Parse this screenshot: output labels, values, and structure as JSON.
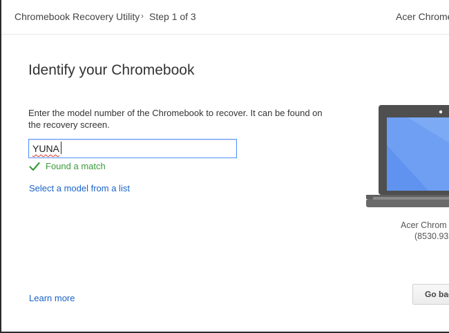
{
  "header": {
    "app_title": "Chromebook Recovery Utility",
    "separator": "›",
    "step": "Step 1 of 3",
    "device_name": "Acer Chrome"
  },
  "main": {
    "title": "Identify your Chromebook",
    "instructions": "Enter the model number of the Chromebook to recover. It can be found on the recovery screen.",
    "model_input": {
      "value": "YUNA",
      "placeholder": ""
    },
    "match_status": "Found a match",
    "select_model_link": "Select a model from a list",
    "learn_more_link": "Learn more"
  },
  "device_preview": {
    "name_line1": "Acer Chrom",
    "name_line2": "(8530.93"
  },
  "footer": {
    "go_back_label": "Go bac"
  },
  "colors": {
    "accent": "#1a62c7",
    "success": "#3a9b3a",
    "input_focus": "#4d90fe",
    "screen_blue": "#6e9ff3"
  },
  "icons": {
    "match": "checkmark-icon",
    "device": "laptop-icon"
  }
}
